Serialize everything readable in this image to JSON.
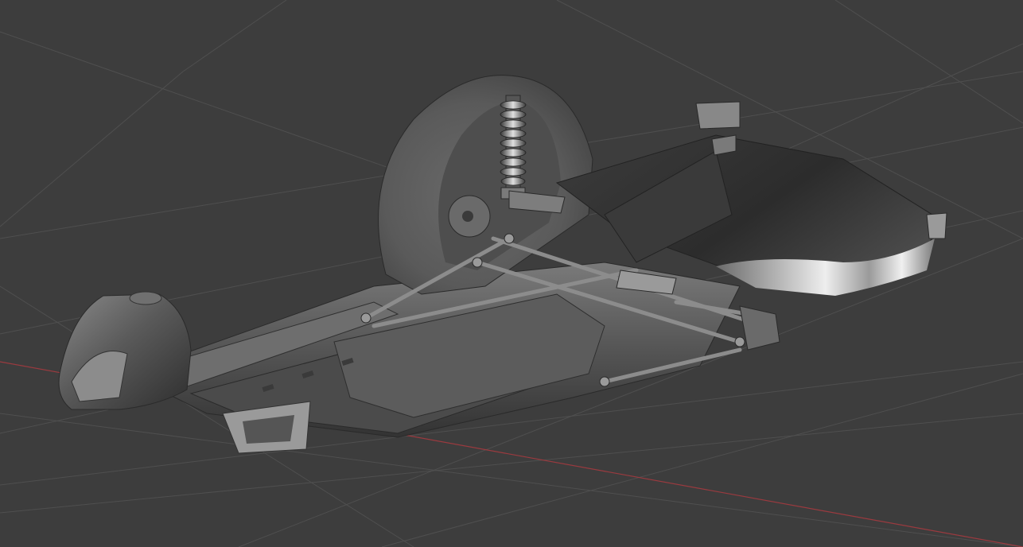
{
  "viewport": {
    "background": "#3d3d3d",
    "grid_color": "#4e4e4e",
    "x_axis_color": "#9b3a3f",
    "model_base_color": "#5e5e5e",
    "model_highlight_color": "#d8d8d8",
    "model_shadow_color": "#262626"
  },
  "scene": {
    "objects": [
      "chassis-frame",
      "fender",
      "coil-spring-shock",
      "seat-pan",
      "front-nose",
      "suspension-arms",
      "floor-pan"
    ]
  }
}
